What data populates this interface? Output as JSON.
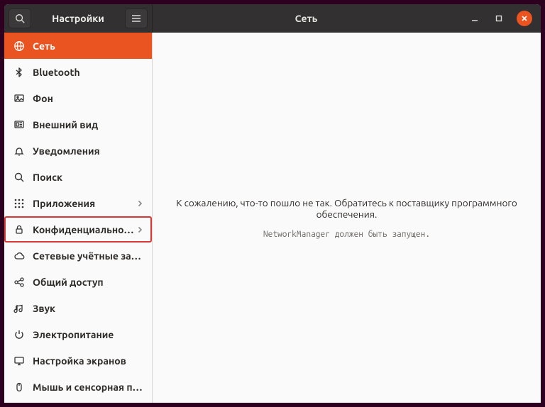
{
  "titlebar": {
    "left_title": "Настройки",
    "right_title": "Сеть"
  },
  "sidebar": {
    "items": [
      {
        "label": "Сеть",
        "icon": "globe-icon",
        "has_sub": false,
        "active": true,
        "highlighted": false
      },
      {
        "label": "Bluetooth",
        "icon": "bluetooth-icon",
        "has_sub": false,
        "active": false,
        "highlighted": false
      },
      {
        "label": "Фон",
        "icon": "background-icon",
        "has_sub": false,
        "active": false,
        "highlighted": false
      },
      {
        "label": "Внешний вид",
        "icon": "appearance-icon",
        "has_sub": false,
        "active": false,
        "highlighted": false
      },
      {
        "label": "Уведомления",
        "icon": "bell-icon",
        "has_sub": false,
        "active": false,
        "highlighted": false
      },
      {
        "label": "Поиск",
        "icon": "search-icon",
        "has_sub": false,
        "active": false,
        "highlighted": false
      },
      {
        "label": "Приложения",
        "icon": "apps-icon",
        "has_sub": true,
        "active": false,
        "highlighted": false
      },
      {
        "label": "Конфиденциальность",
        "icon": "lock-icon",
        "has_sub": true,
        "active": false,
        "highlighted": true
      },
      {
        "label": "Сетевые учётные записи",
        "icon": "cloud-icon",
        "has_sub": false,
        "active": false,
        "highlighted": false
      },
      {
        "label": "Общий доступ",
        "icon": "share-icon",
        "has_sub": false,
        "active": false,
        "highlighted": false
      },
      {
        "label": "Звук",
        "icon": "sound-icon",
        "has_sub": false,
        "active": false,
        "highlighted": false
      },
      {
        "label": "Электропитание",
        "icon": "power-icon",
        "has_sub": false,
        "active": false,
        "highlighted": false
      },
      {
        "label": "Настройка экранов",
        "icon": "display-icon",
        "has_sub": false,
        "active": false,
        "highlighted": false
      },
      {
        "label": "Мышь и сенсорная панель",
        "icon": "mouse-icon",
        "has_sub": false,
        "active": false,
        "highlighted": false
      }
    ]
  },
  "content": {
    "error_message": "К сожалению, что-то пошло не так. Обратитесь к поставщику программного обеспечения.",
    "error_sub": "NetworkManager должен быть запущен."
  },
  "colors": {
    "accent": "#e95420",
    "titlebar": "#323030",
    "highlight_border": "#d93636"
  }
}
